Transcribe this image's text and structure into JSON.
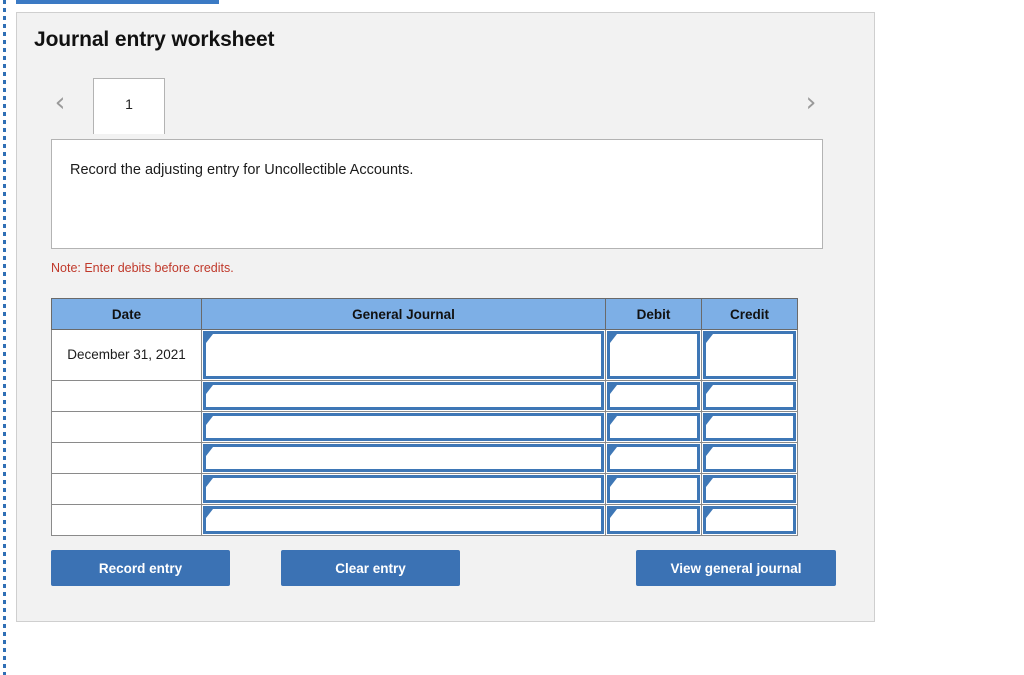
{
  "header": {
    "title": "Journal entry worksheet"
  },
  "tabs": {
    "prev_icon": "chevron-left-icon",
    "next_icon": "chevron-right-icon",
    "items": [
      {
        "label": "1",
        "active": true
      }
    ]
  },
  "instruction": {
    "text": "Record the adjusting entry for Uncollectible Accounts."
  },
  "note": {
    "text": "Note: Enter debits before credits."
  },
  "table": {
    "columns": [
      "Date",
      "General Journal",
      "Debit",
      "Credit"
    ],
    "rows": [
      {
        "date": "December 31, 2021",
        "general_journal": "",
        "debit": "",
        "credit": ""
      },
      {
        "date": "",
        "general_journal": "",
        "debit": "",
        "credit": ""
      },
      {
        "date": "",
        "general_journal": "",
        "debit": "",
        "credit": ""
      },
      {
        "date": "",
        "general_journal": "",
        "debit": "",
        "credit": ""
      },
      {
        "date": "",
        "general_journal": "",
        "debit": "",
        "credit": ""
      },
      {
        "date": "",
        "general_journal": "",
        "debit": "",
        "credit": ""
      }
    ]
  },
  "actions": {
    "record_label": "Record entry",
    "clear_label": "Clear entry",
    "view_label": "View general journal"
  },
  "colors": {
    "header_blue": "#7dafe6",
    "button_blue": "#3b72b4",
    "input_border_blue": "#3e77b6",
    "note_red": "#c0392b",
    "panel_grey": "#f2f2f2",
    "rail_blue": "#2f6fb5"
  }
}
